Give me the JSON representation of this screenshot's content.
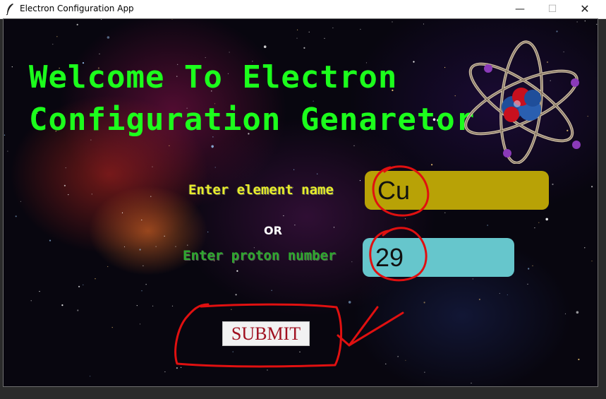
{
  "window": {
    "title": "Electron Configuration App",
    "minimize": "—",
    "maximize": "☐",
    "close": "✕"
  },
  "main": {
    "heading_line1": "Welcome To Electron",
    "heading_line2": "Configuration Genaretor",
    "element_label": "Enter element name",
    "or_label": "OR",
    "proton_label": "Enter proton number",
    "element_value": "Cu",
    "proton_value": "29",
    "submit_label": "SUBMIT"
  },
  "colors": {
    "heading": "#1cff1c",
    "element_label": "#e8ec2a",
    "proton_label": "#2ea82e",
    "element_field_bg": "#b8a206",
    "proton_field_bg": "#66c6cc",
    "submit_text": "#a01020",
    "annotation": "#e01010"
  },
  "icons": {
    "app_icon": "feather-icon",
    "logo": "atom-icon"
  }
}
